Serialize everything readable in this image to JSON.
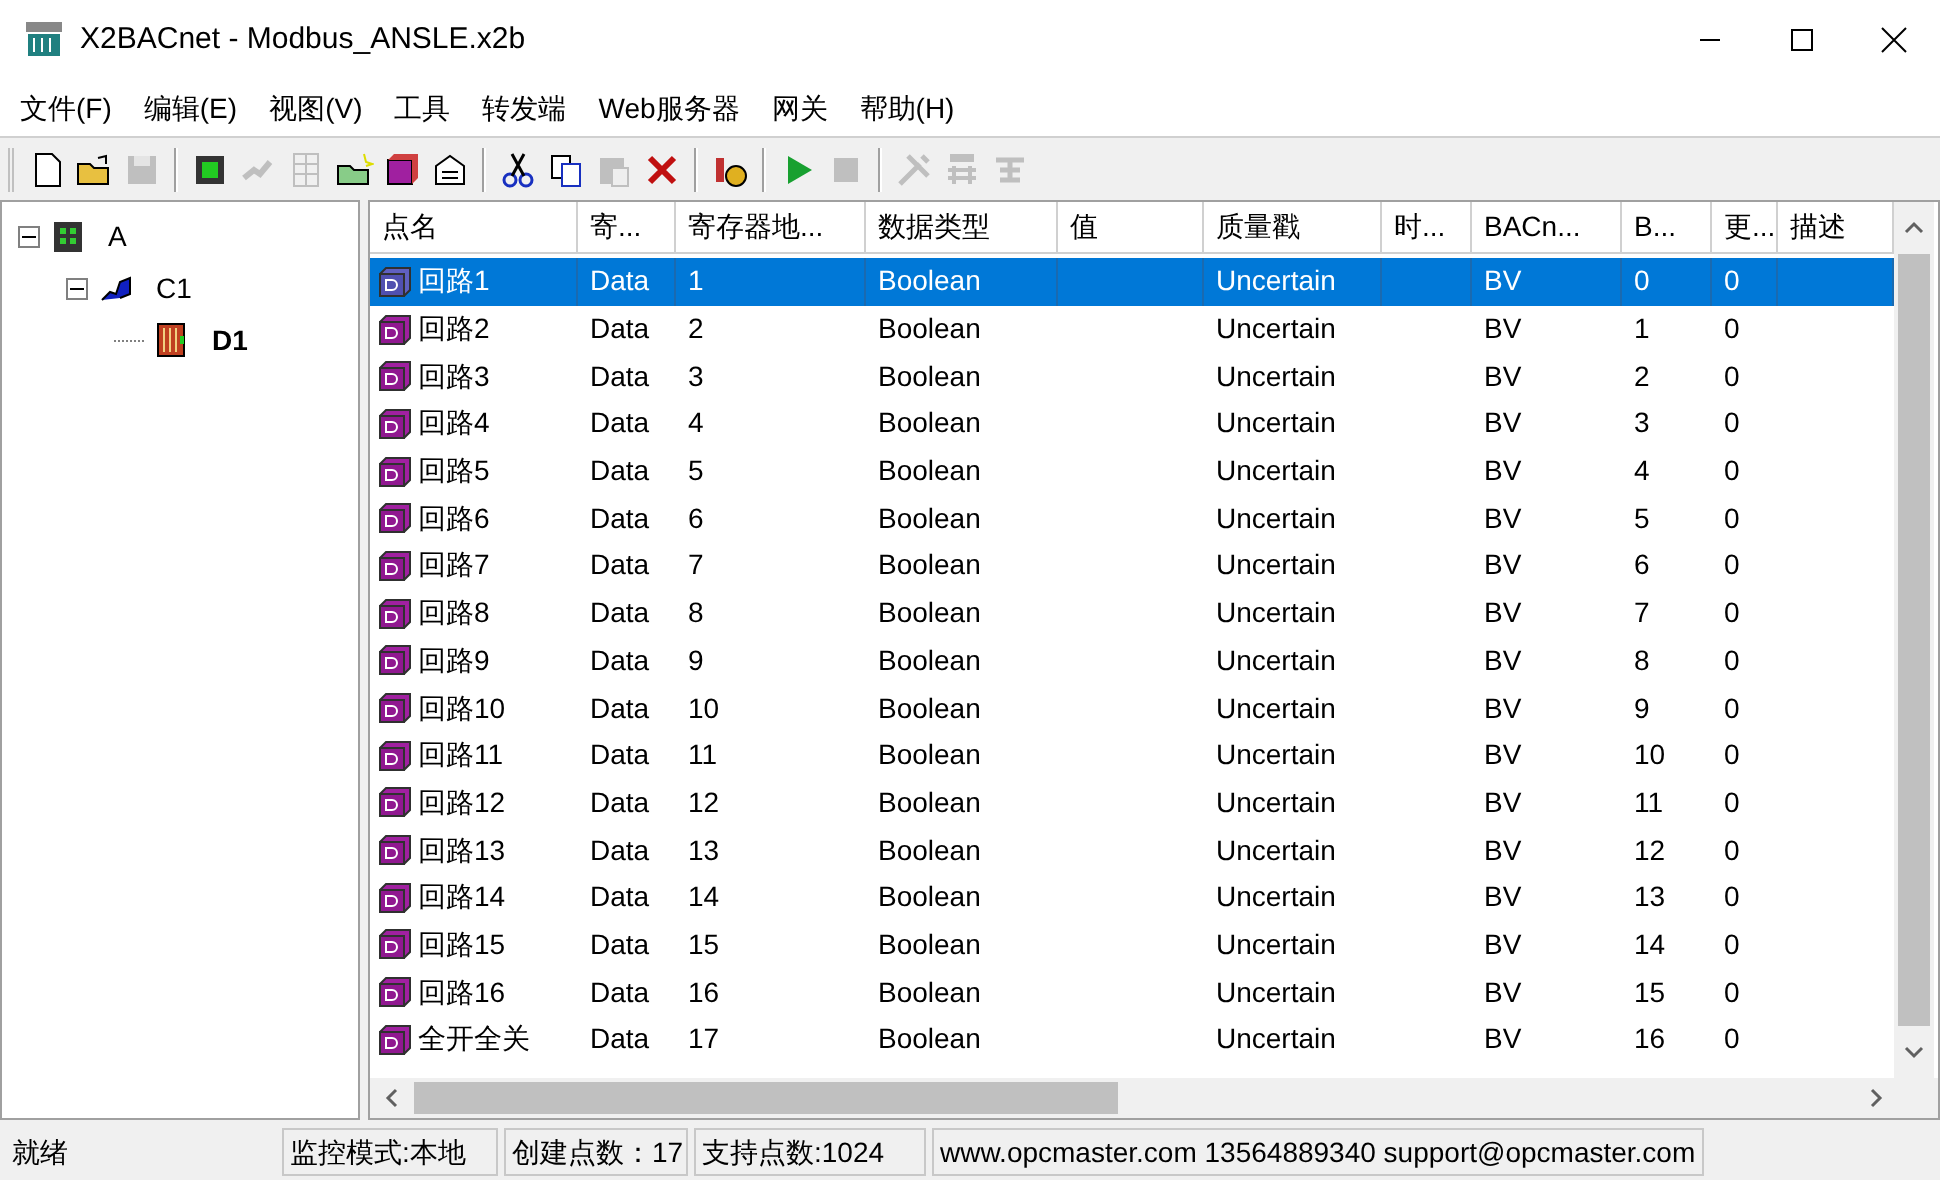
{
  "window": {
    "title": "X2BACnet - Modbus_ANSLE.x2b"
  },
  "menu": [
    "文件(F)",
    "编辑(E)",
    "视图(V)",
    "工具",
    "转发端",
    "Web服务器",
    "网关",
    "帮助(H)"
  ],
  "toolbar": [
    {
      "disabled": false
    },
    {
      "disabled": false
    },
    {
      "disabled": true
    },
    {
      "disabled": false
    },
    {
      "disabled": true
    },
    {
      "disabled": true
    },
    {
      "disabled": false
    },
    {
      "disabled": false
    },
    {
      "disabled": false
    },
    {
      "disabled": false
    },
    {
      "disabled": false
    },
    {
      "disabled": true
    },
    {
      "disabled": false
    },
    {
      "disabled": false
    },
    {
      "disabled": false
    },
    {
      "disabled": true
    },
    {
      "disabled": true
    },
    {
      "disabled": true
    },
    {
      "disabled": true
    }
  ],
  "tree": [
    {
      "label": "A",
      "expanded": true,
      "selected": false,
      "children": [
        {
          "label": "C1",
          "expanded": true,
          "selected": false,
          "children": [
            {
              "label": "D1",
              "selected": true
            }
          ]
        }
      ]
    }
  ],
  "table": {
    "columns": [
      "点名",
      "寄...",
      "寄存器地...",
      "数据类型",
      "值",
      "质量戳",
      "时...",
      "BACn...",
      "B...",
      "更...",
      "描述"
    ],
    "rows": [
      {
        "selected": true,
        "cells": [
          "回路1",
          "Data",
          "1",
          "Boolean",
          "",
          "Uncertain",
          "",
          "BV",
          "0",
          "0",
          ""
        ]
      },
      {
        "selected": false,
        "cells": [
          "回路2",
          "Data",
          "2",
          "Boolean",
          "",
          "Uncertain",
          "",
          "BV",
          "1",
          "0",
          ""
        ]
      },
      {
        "selected": false,
        "cells": [
          "回路3",
          "Data",
          "3",
          "Boolean",
          "",
          "Uncertain",
          "",
          "BV",
          "2",
          "0",
          ""
        ]
      },
      {
        "selected": false,
        "cells": [
          "回路4",
          "Data",
          "4",
          "Boolean",
          "",
          "Uncertain",
          "",
          "BV",
          "3",
          "0",
          ""
        ]
      },
      {
        "selected": false,
        "cells": [
          "回路5",
          "Data",
          "5",
          "Boolean",
          "",
          "Uncertain",
          "",
          "BV",
          "4",
          "0",
          ""
        ]
      },
      {
        "selected": false,
        "cells": [
          "回路6",
          "Data",
          "6",
          "Boolean",
          "",
          "Uncertain",
          "",
          "BV",
          "5",
          "0",
          ""
        ]
      },
      {
        "selected": false,
        "cells": [
          "回路7",
          "Data",
          "7",
          "Boolean",
          "",
          "Uncertain",
          "",
          "BV",
          "6",
          "0",
          ""
        ]
      },
      {
        "selected": false,
        "cells": [
          "回路8",
          "Data",
          "8",
          "Boolean",
          "",
          "Uncertain",
          "",
          "BV",
          "7",
          "0",
          ""
        ]
      },
      {
        "selected": false,
        "cells": [
          "回路9",
          "Data",
          "9",
          "Boolean",
          "",
          "Uncertain",
          "",
          "BV",
          "8",
          "0",
          ""
        ]
      },
      {
        "selected": false,
        "cells": [
          "回路10",
          "Data",
          "10",
          "Boolean",
          "",
          "Uncertain",
          "",
          "BV",
          "9",
          "0",
          ""
        ]
      },
      {
        "selected": false,
        "cells": [
          "回路11",
          "Data",
          "11",
          "Boolean",
          "",
          "Uncertain",
          "",
          "BV",
          "10",
          "0",
          ""
        ]
      },
      {
        "selected": false,
        "cells": [
          "回路12",
          "Data",
          "12",
          "Boolean",
          "",
          "Uncertain",
          "",
          "BV",
          "11",
          "0",
          ""
        ]
      },
      {
        "selected": false,
        "cells": [
          "回路13",
          "Data",
          "13",
          "Boolean",
          "",
          "Uncertain",
          "",
          "BV",
          "12",
          "0",
          ""
        ]
      },
      {
        "selected": false,
        "cells": [
          "回路14",
          "Data",
          "14",
          "Boolean",
          "",
          "Uncertain",
          "",
          "BV",
          "13",
          "0",
          ""
        ]
      },
      {
        "selected": false,
        "cells": [
          "回路15",
          "Data",
          "15",
          "Boolean",
          "",
          "Uncertain",
          "",
          "BV",
          "14",
          "0",
          ""
        ]
      },
      {
        "selected": false,
        "cells": [
          "回路16",
          "Data",
          "16",
          "Boolean",
          "",
          "Uncertain",
          "",
          "BV",
          "15",
          "0",
          ""
        ]
      },
      {
        "selected": false,
        "cells": [
          "全开全关",
          "Data",
          "17",
          "Boolean",
          "",
          "Uncertain",
          "",
          "BV",
          "16",
          "0",
          ""
        ]
      }
    ]
  },
  "status_bar": [
    "就绪",
    "监控模式:本地",
    "创建点数：17",
    "支持点数:1024",
    "www.opcmaster.com 13564889340 support@opcmaster.com"
  ]
}
